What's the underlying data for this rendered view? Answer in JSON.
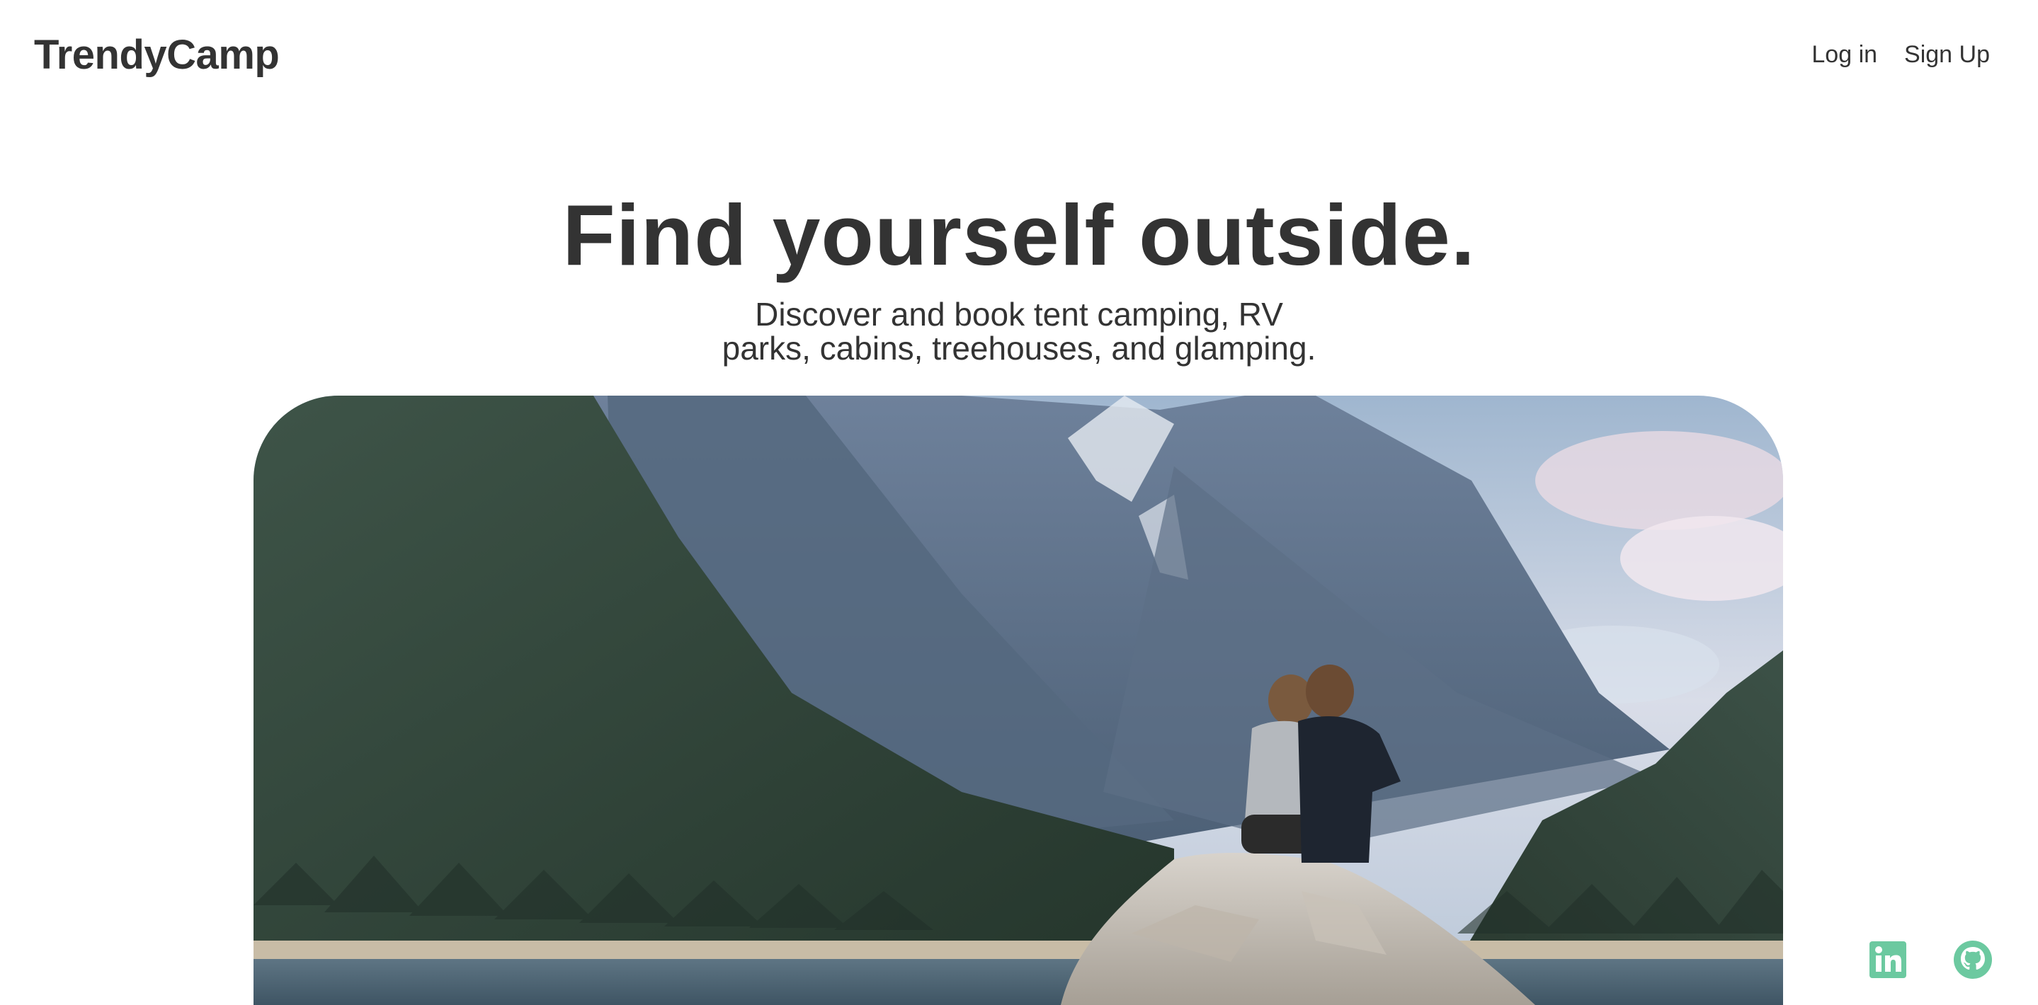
{
  "header": {
    "logo": "TrendyCamp",
    "nav": {
      "login_label": "Log in",
      "signup_label": "Sign Up"
    }
  },
  "hero": {
    "headline": "Find yourself outside.",
    "subhead_line1": "Discover and book tent camping, RV",
    "subhead_line2": "parks, cabins, treehouses, and glamping."
  },
  "social": {
    "linkedin_icon": "linkedin-icon",
    "github_icon": "github-icon",
    "accent_color": "#6cc9a0"
  }
}
